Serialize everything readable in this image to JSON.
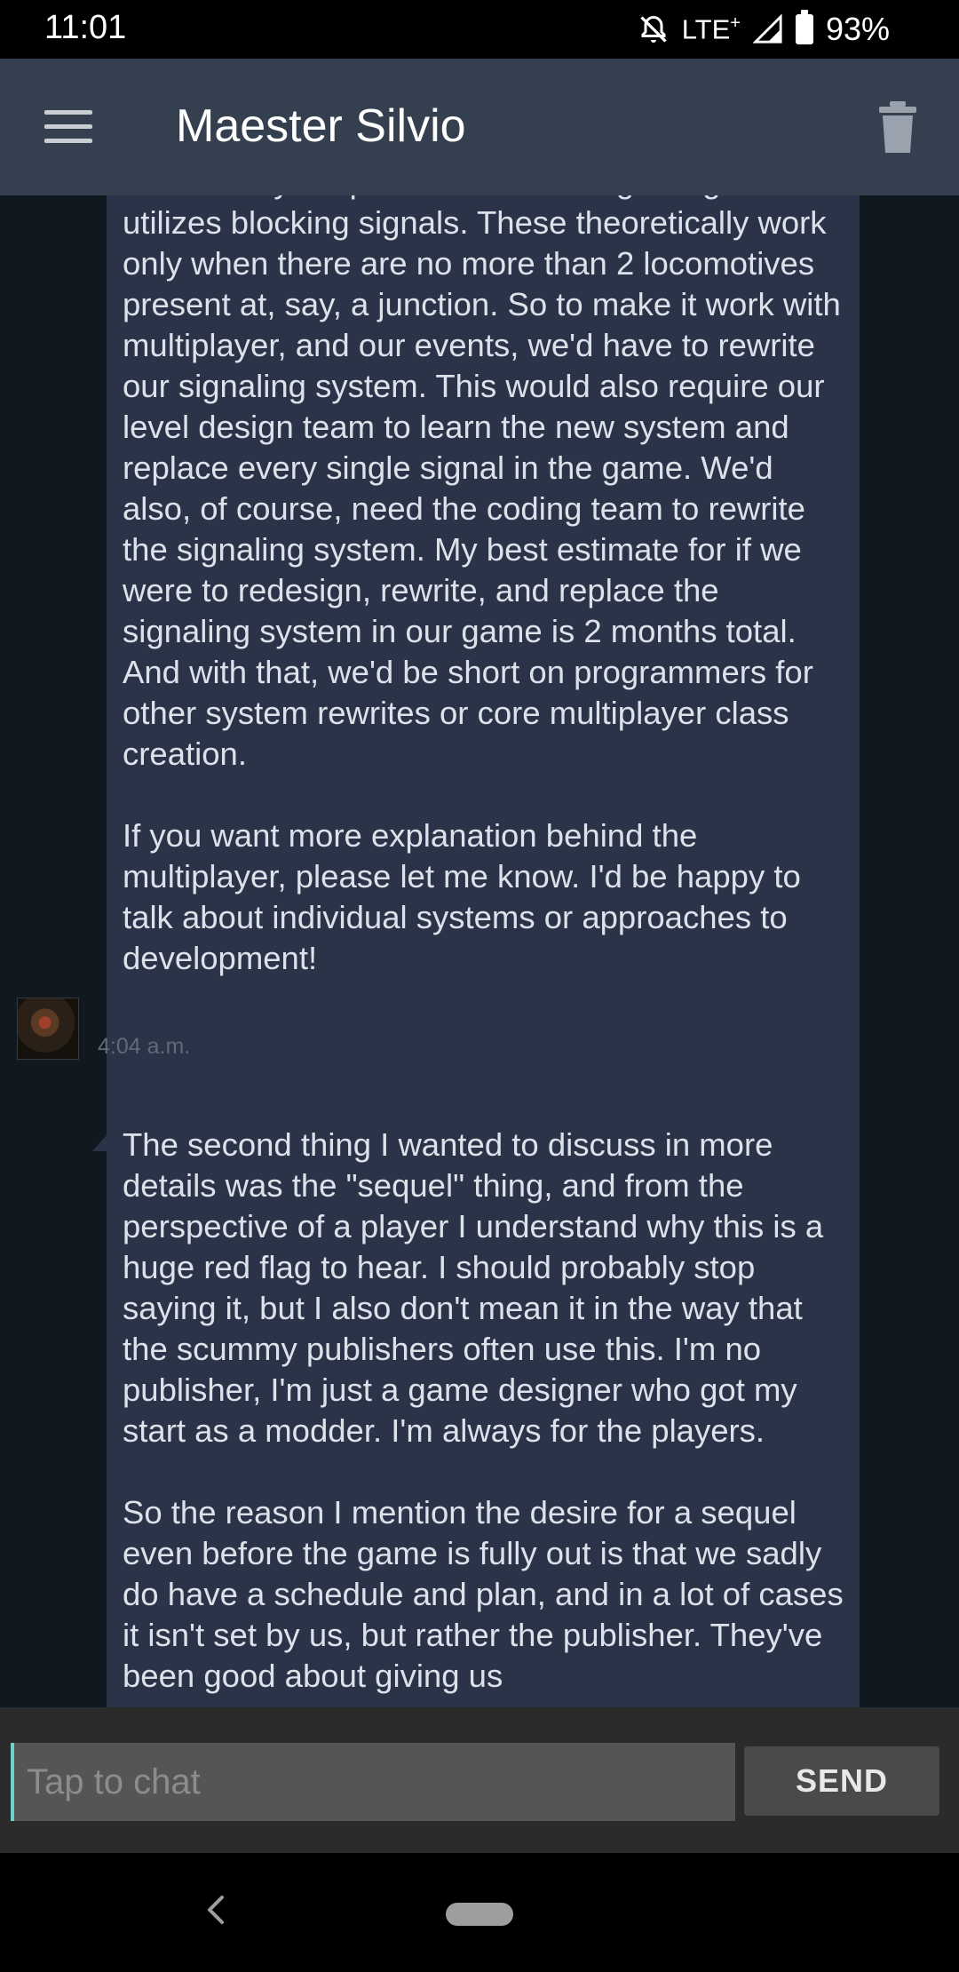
{
  "status_bar": {
    "time": "11:01",
    "network": "LTE",
    "network_plus": "+",
    "battery": "93%",
    "icons": [
      "mute-icon",
      "signal-icon",
      "battery-icon"
    ]
  },
  "header": {
    "title": "Maester Silvio",
    "icons": [
      "menu-icon",
      "trash-icon"
    ]
  },
  "messages": [
    {
      "text": "have a very simplified version of signaling that utilizes blocking signals. These theoretically work only when there are no more than 2 locomotives present at, say, a junction. So to make it work with multiplayer, and our events, we'd have to rewrite our signaling system. This would also require our level design team to learn the new system and replace every single signal in the game. We'd also, of course, need the coding team to rewrite the signaling system. My best estimate for if we were to redesign, rewrite, and replace the signaling system in our game is 2 months total. And with that, we'd be short on programmers for other system rewrites or core multiplayer class creation.\n\nIf you want more explanation behind the multiplayer, please let me know. I'd be happy to talk about individual systems or approaches to development!",
      "timestamp": "4:04 a.m."
    },
    {
      "text": "The second thing I wanted to discuss in more details was the \"sequel\" thing, and from the perspective of a player I understand why this is a huge red flag to hear. I should probably stop saying it, but I also don't mean it in the way that the scummy publishers often use this. I'm no publisher, I'm just a game designer who got my start as a modder. I'm always for the players.\n\nSo the reason I mention the desire for a sequel even before the game is fully out is that we sadly do have a schedule and plan, and in a lot of cases it isn't set by us, but rather the publisher. They've been good about giving us"
    }
  ],
  "input": {
    "placeholder": "Tap to chat",
    "value": ""
  },
  "send_button": {
    "label": "SEND"
  },
  "colors": {
    "background": "#101820",
    "header": "#34404f",
    "bubble": "#2b3348",
    "bubble_text": "#dde2ea",
    "cursor_accent": "#6fd1c9"
  }
}
